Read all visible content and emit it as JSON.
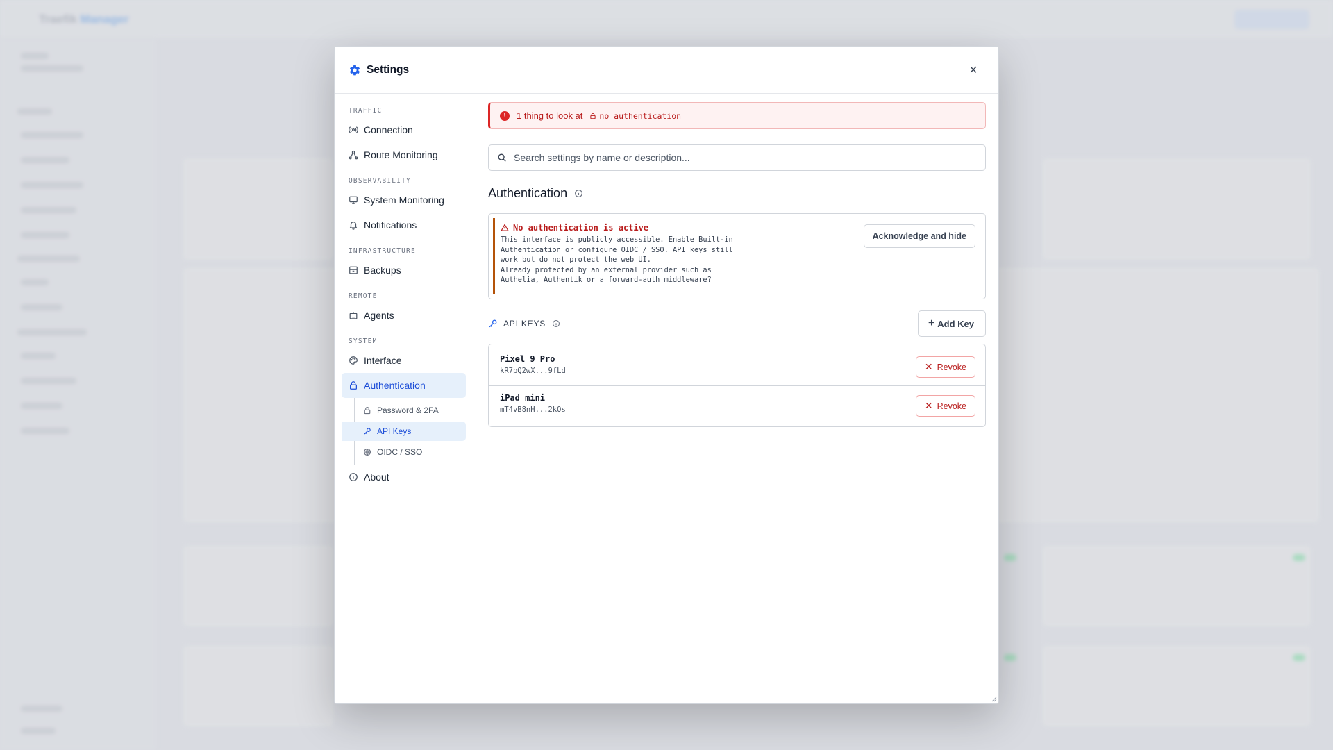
{
  "modal": {
    "title": "Settings",
    "icon": "gear-icon",
    "close_label": "×"
  },
  "nav": {
    "sections": [
      {
        "label": "TRAFFIC",
        "items": [
          "Connection",
          "Route Monitoring"
        ]
      },
      {
        "label": "OBSERVABILITY",
        "items": [
          "System Monitoring",
          "Notifications"
        ]
      },
      {
        "label": "INFRASTRUCTURE",
        "items": [
          "Backups"
        ]
      },
      {
        "label": "REMOTE",
        "items": [
          "Agents"
        ]
      },
      {
        "label": "SYSTEM",
        "items": [
          "Interface",
          "Authentication"
        ]
      }
    ],
    "auth_sub": [
      "Password & 2FA",
      "API Keys",
      "OIDC / SSO"
    ],
    "about": "About",
    "active_item": "Authentication",
    "active_sub": "API Keys"
  },
  "alert": {
    "text": "1 thing to look at",
    "tag": "no authentication"
  },
  "search": {
    "placeholder": "Search settings by name or description..."
  },
  "section": {
    "title": "Authentication"
  },
  "warning": {
    "title": "No authentication is active",
    "line1": "This interface is publicly accessible. Enable Built-in Authentication or configure OIDC / SSO. API keys still work but do not protect the web UI.",
    "line2": "Already protected by an external provider such as Authelia, Authentik or a forward-auth middleware?",
    "ack_label": "Acknowledge and hide"
  },
  "api_keys": {
    "label": "API KEYS",
    "add_label": "Add Key",
    "keys": [
      {
        "name": "Pixel 9 Pro",
        "value": "kR7pQ2wX...9fLd",
        "revoke": "Revoke"
      },
      {
        "name": "iPad mini",
        "value": "mT4vB8nH...2kQs",
        "revoke": "Revoke"
      }
    ]
  },
  "background": {
    "brand": "Traefik",
    "brand_accent": "Manager"
  },
  "colors": {
    "accent": "#1d4ed8",
    "danger": "#dc2626",
    "warning": "#b45309",
    "active_bg": "#e6f0fb"
  }
}
